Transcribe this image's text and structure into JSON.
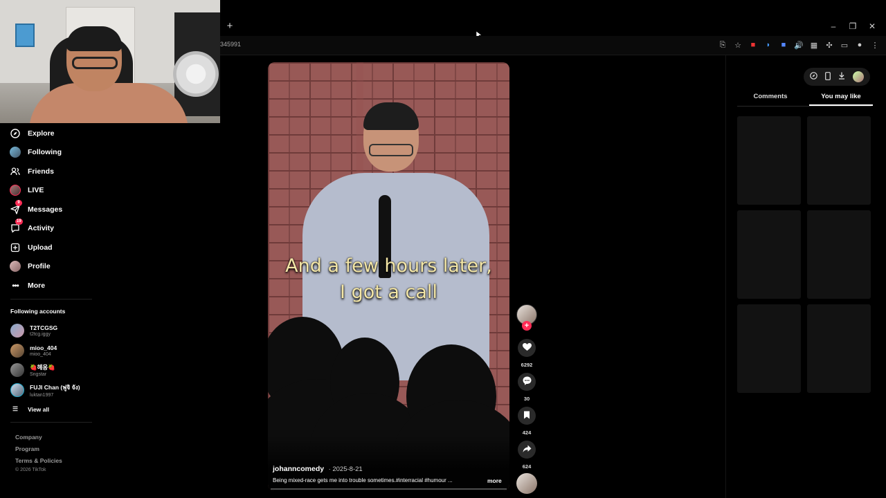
{
  "browser": {
    "new_tab": "+",
    "url_fragment": "345991",
    "window_controls": {
      "minimize": "–",
      "maximize": "❐",
      "close": "✕"
    },
    "toolbar_icons": [
      "install-icon",
      "star-icon",
      "extension-red-icon",
      "extension-blue-icon",
      "extension-shield-icon",
      "volume-icon",
      "extension-gray-icon",
      "puzzle-icon",
      "cast-icon",
      "profile-icon",
      "kebab-menu-icon"
    ]
  },
  "sidebar": {
    "nav": [
      {
        "label": "Explore",
        "icon": "compass-icon"
      },
      {
        "label": "Following",
        "icon": "following-avatar-icon"
      },
      {
        "label": "Friends",
        "icon": "friends-icon"
      },
      {
        "label": "LIVE",
        "icon": "live-icon"
      },
      {
        "label": "Messages",
        "icon": "paper-plane-icon",
        "badge": "9"
      },
      {
        "label": "Activity",
        "icon": "inbox-icon",
        "badge": "19"
      },
      {
        "label": "Upload",
        "icon": "upload-icon"
      },
      {
        "label": "Profile",
        "icon": "profile-avatar-icon"
      },
      {
        "label": "More",
        "icon": "more-dots-icon"
      }
    ],
    "following_title": "Following accounts",
    "accounts": [
      {
        "name": "T2TCGSG",
        "handle": "t2tcg.iggy"
      },
      {
        "name": "mioo_404",
        "handle": "mioo_404"
      },
      {
        "name": "🍓헤옹🍓",
        "handle": "Sngstar"
      },
      {
        "name": "FUJI Chan (ฟูจิ จัง)",
        "handle": "luktan1997"
      }
    ],
    "view_all": "View all",
    "footer": {
      "company": "Company",
      "program": "Program",
      "terms": "Terms & Policies",
      "copyright": "© 2026 TikTok"
    }
  },
  "video": {
    "caption_line1": "And a few hours later,",
    "caption_line2": "I got a call",
    "author": "johanncomedy",
    "date": "· 2025-8-21",
    "description": "Being mixed-race gets me into trouble sometimes.#interracial #humour ...",
    "more": "more"
  },
  "actions": {
    "follow_plus": "+",
    "likes": "6292",
    "comments": "30",
    "saves": "424",
    "shares": "624"
  },
  "right_panel": {
    "tabs": [
      "Comments",
      "You may like"
    ],
    "active_tab": "You may like",
    "icons": [
      "compass-icon",
      "phone-icon",
      "download-icon",
      "profile-avatar-icon"
    ]
  }
}
